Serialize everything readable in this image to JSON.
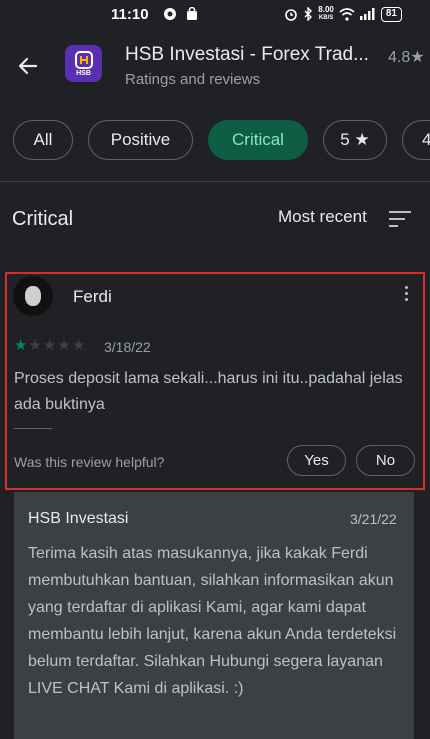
{
  "status_bar": {
    "time": "11:10",
    "net_speed_value": "8.00",
    "net_speed_unit": "KB/S",
    "battery": "81"
  },
  "header": {
    "app_title": "HSB Investasi - Forex Trad...",
    "rating": "4.8★",
    "subtitle": "Ratings and reviews",
    "app_icon_text": "HSB"
  },
  "filters": [
    {
      "label": "All",
      "active": false
    },
    {
      "label": "Positive",
      "active": false
    },
    {
      "label": "Critical",
      "active": true
    },
    {
      "label": "5 ★",
      "active": false
    },
    {
      "label": "4",
      "active": false
    }
  ],
  "section": {
    "title": "Critical",
    "sort_label": "Most recent"
  },
  "review": {
    "author": "Ferdi",
    "rating": 1,
    "max_rating": 5,
    "date": "3/18/22",
    "text": "Proses deposit lama sekali...harus ini itu..padahal jelas ada buktinya",
    "helpful_prompt": "Was this review helpful?",
    "yes_label": "Yes",
    "no_label": "No"
  },
  "developer_reply": {
    "author": "HSB Investasi",
    "date": "3/21/22",
    "text": "Terima kasih atas masukannya, jika kakak Ferdi membutuhkan bantuan, silahkan informasikan akun yang terdaftar di aplikasi Kami, agar kami dapat membantu lebih lanjut, karena akun Anda terdeteksi belum terdaftar. Silahkan Hubungi segera layanan LIVE CHAT Kami di aplikasi. :)"
  },
  "colors": {
    "background": "#202124",
    "accent_green": "#01875f",
    "active_chip": "#0d5e45",
    "highlight_border": "#d32f2f",
    "reply_background": "#3c4043"
  }
}
